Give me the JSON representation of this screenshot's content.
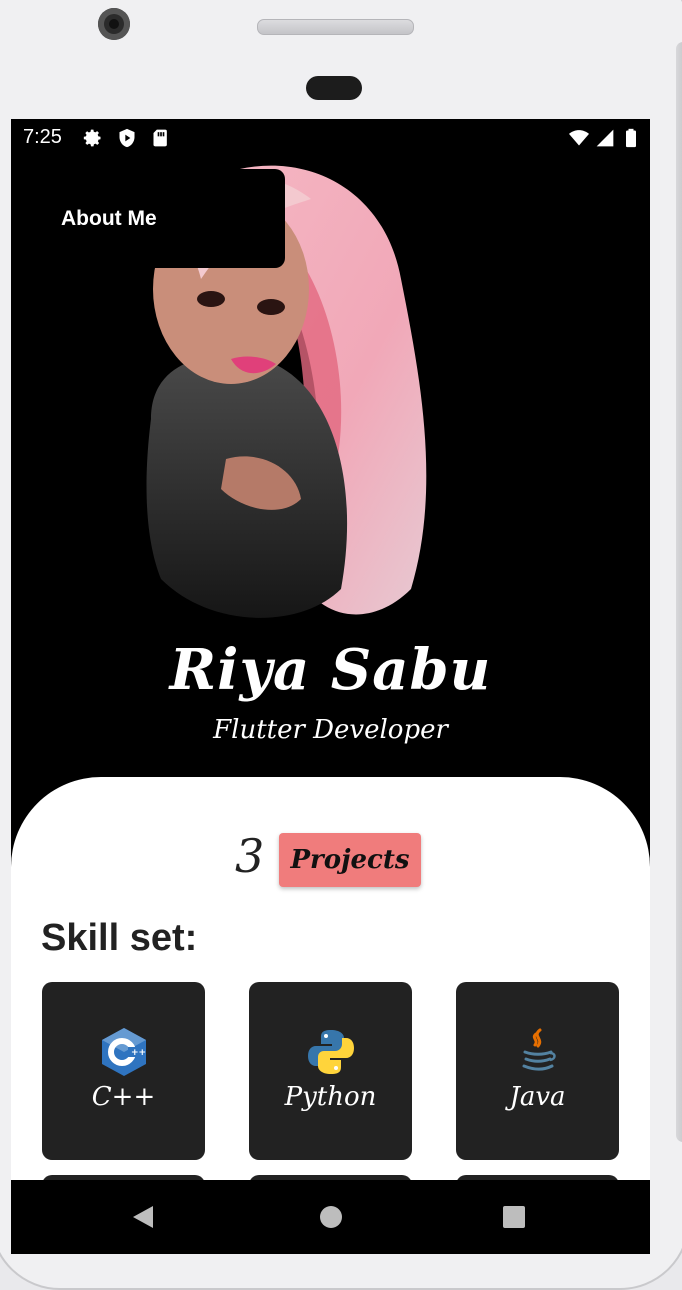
{
  "status_bar": {
    "time": "7:25"
  },
  "header": {
    "about_label": "About Me"
  },
  "profile": {
    "name": "Riya Sabu",
    "role": "Flutter Developer"
  },
  "projects": {
    "count": "3",
    "label": "Projects"
  },
  "skills": {
    "title": "Skill set:",
    "items": [
      {
        "label": "C++",
        "icon": "cpp-logo-icon"
      },
      {
        "label": "Python",
        "icon": "python-logo-icon"
      },
      {
        "label": "Java",
        "icon": "java-logo-icon"
      }
    ]
  },
  "colors": {
    "background": "#000000",
    "sheet": "#ffffff",
    "accent": "#f07c7c",
    "card": "#222222"
  }
}
